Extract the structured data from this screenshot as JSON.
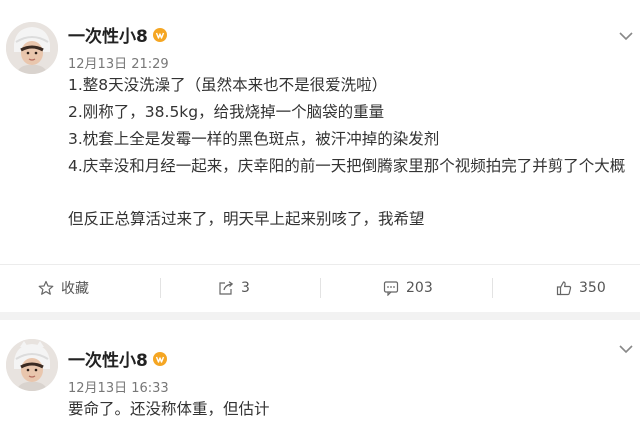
{
  "posts": [
    {
      "username": "一次性小8",
      "time": "12月13日 21:29",
      "lines": [
        "1.整8天没洗澡了（虽然本来也不是很爱洗啦）",
        "2.刚称了，38.5kg，给我烧掉一个脑袋的重量",
        "3.枕套上全是发霉一样的黑色斑点，被汗冲掉的染发剂",
        "4.庆幸没和月经一起来，庆幸阳的前一天把倒腾家里那个视频拍完了并剪了个大概",
        "但反正总算活过来了，明天早上起来别咳了，我希望"
      ],
      "actions": {
        "favorite_label": "收藏",
        "repost_count": "3",
        "comment_count": "203",
        "like_count": "350"
      }
    },
    {
      "username": "一次性小8",
      "time": "12月13日 16:33",
      "lines": [
        "要命了。还没称体重，但估计"
      ]
    }
  ],
  "icons": {
    "vip": "vip-badge-icon",
    "menu": "chevron-down-icon",
    "favorite": "star-outline-icon",
    "repost": "repost-share-icon",
    "comment": "comment-bubble-icon",
    "like": "thumbs-up-icon"
  },
  "colors": {
    "vip_badge": "#f5a623",
    "separator": "#f2f2f2",
    "text": "#333333",
    "time": "#777777"
  }
}
